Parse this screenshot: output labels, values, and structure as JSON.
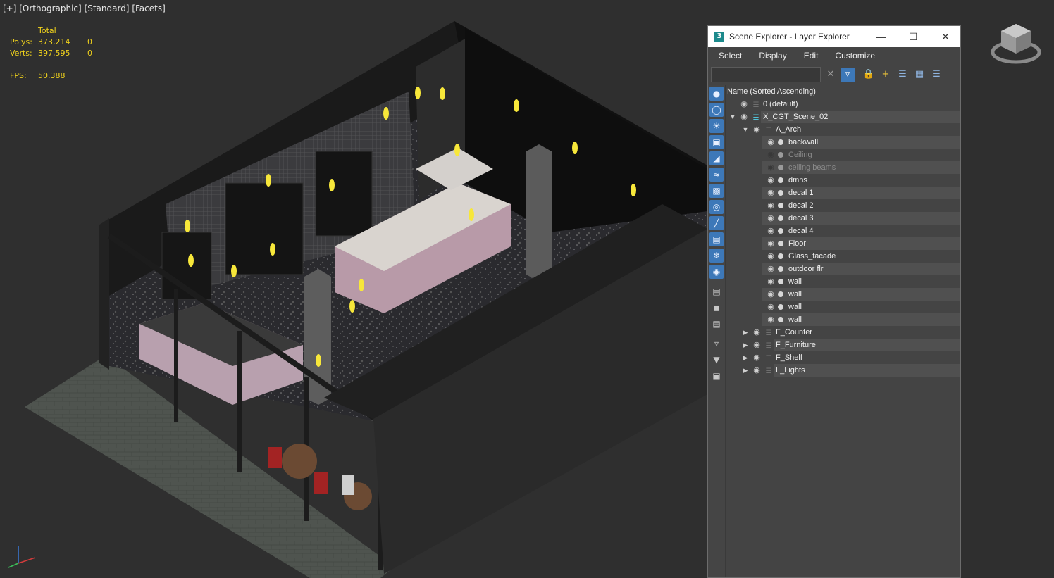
{
  "viewport": {
    "label_parts": [
      "[+]",
      "[Orthographic]",
      "[Standard]",
      "[Facets]"
    ],
    "stats": {
      "header": "Total",
      "polys_label": "Polys:",
      "polys_value": "373,214",
      "polys_sel": "0",
      "verts_label": "Verts:",
      "verts_value": "397,595",
      "verts_sel": "0",
      "fps_label": "FPS:",
      "fps_value": "50.388"
    },
    "stats_color": "#f0d21c"
  },
  "explorer": {
    "title": "Scene Explorer - Layer Explorer",
    "app_icon": "3",
    "menu": [
      "Select",
      "Display",
      "Edit",
      "Customize"
    ],
    "search": {
      "value": "",
      "placeholder": ""
    },
    "column_header": "Name (Sorted Ascending)",
    "accent": "#3d78b8",
    "rows": [
      {
        "name": "0 (default)",
        "level": 0,
        "expand": "",
        "eye": true,
        "type": "layer",
        "dim": false
      },
      {
        "name": "X_CGT_Scene_02",
        "level": 0,
        "expand": "open",
        "eye": true,
        "type": "layer-active",
        "dim": false
      },
      {
        "name": "A_Arch",
        "level": 1,
        "expand": "open",
        "eye": true,
        "type": "layer",
        "dim": false
      },
      {
        "name": "backwall",
        "level": 2,
        "expand": "",
        "eye": true,
        "type": "object",
        "dim": false
      },
      {
        "name": "Ceiling",
        "level": 2,
        "expand": "",
        "eye": false,
        "type": "object",
        "dim": true
      },
      {
        "name": "ceiling beams",
        "level": 2,
        "expand": "",
        "eye": false,
        "type": "object",
        "dim": true
      },
      {
        "name": "dmns",
        "level": 2,
        "expand": "",
        "eye": true,
        "type": "object",
        "dim": false
      },
      {
        "name": "decal 1",
        "level": 2,
        "expand": "",
        "eye": true,
        "type": "object",
        "dim": false
      },
      {
        "name": "decal 2",
        "level": 2,
        "expand": "",
        "eye": true,
        "type": "object",
        "dim": false
      },
      {
        "name": "decal 3",
        "level": 2,
        "expand": "",
        "eye": true,
        "type": "object",
        "dim": false
      },
      {
        "name": "decal 4",
        "level": 2,
        "expand": "",
        "eye": true,
        "type": "object",
        "dim": false
      },
      {
        "name": "Floor",
        "level": 2,
        "expand": "",
        "eye": true,
        "type": "object",
        "dim": false
      },
      {
        "name": "Glass_facade",
        "level": 2,
        "expand": "",
        "eye": true,
        "type": "object",
        "dim": false
      },
      {
        "name": "outdoor flr",
        "level": 2,
        "expand": "",
        "eye": true,
        "type": "object",
        "dim": false
      },
      {
        "name": "wall",
        "level": 2,
        "expand": "",
        "eye": true,
        "type": "object",
        "dim": false
      },
      {
        "name": "wall",
        "level": 2,
        "expand": "",
        "eye": true,
        "type": "object",
        "dim": false
      },
      {
        "name": "wall",
        "level": 2,
        "expand": "",
        "eye": true,
        "type": "object",
        "dim": false
      },
      {
        "name": "wall",
        "level": 2,
        "expand": "",
        "eye": true,
        "type": "object",
        "dim": false
      },
      {
        "name": "F_Counter",
        "level": 1,
        "expand": "closed",
        "eye": true,
        "type": "layer",
        "dim": false
      },
      {
        "name": "F_Furniture",
        "level": 1,
        "expand": "closed",
        "eye": true,
        "type": "layer",
        "dim": false
      },
      {
        "name": "F_Shelf",
        "level": 1,
        "expand": "closed",
        "eye": true,
        "type": "layer",
        "dim": false
      },
      {
        "name": "L_Lights",
        "level": 1,
        "expand": "closed",
        "eye": true,
        "type": "layer",
        "dim": false
      }
    ]
  }
}
